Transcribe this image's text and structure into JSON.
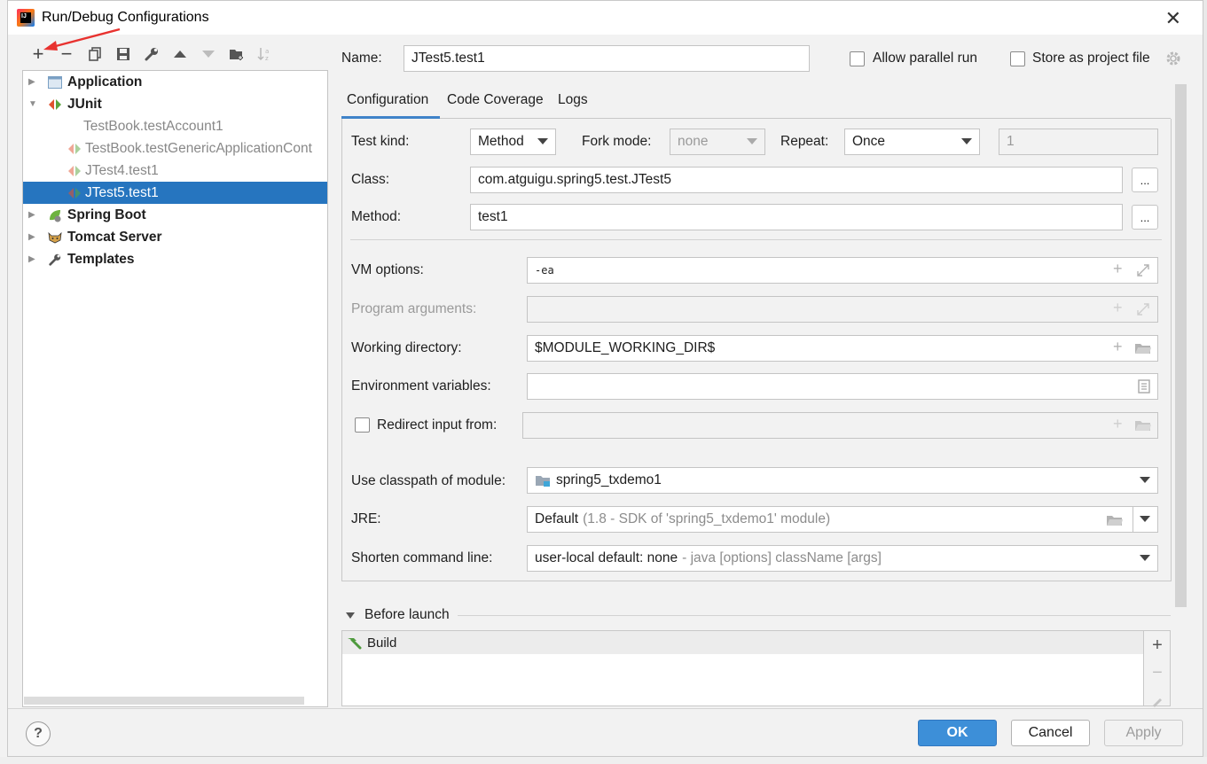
{
  "window": {
    "title": "Run/Debug Configurations",
    "app_icon": "intellij-icon",
    "close": "✕"
  },
  "toolbar": {
    "items": [
      {
        "name": "add-icon",
        "glyph": "+"
      },
      {
        "name": "remove-icon",
        "glyph": "−"
      },
      {
        "name": "copy-icon",
        "glyph": "⧉"
      },
      {
        "name": "save-icon",
        "glyph": "▣"
      },
      {
        "name": "wrench-icon",
        "glyph": "🔧"
      },
      {
        "name": "move-up-icon",
        "glyph": "▲"
      },
      {
        "name": "move-down-icon",
        "glyph": "▼"
      },
      {
        "name": "new-folder-icon",
        "glyph": "▰"
      },
      {
        "name": "sort-icon",
        "glyph": "↓ᵃᶻ"
      }
    ]
  },
  "tree": {
    "application": "Application",
    "junit": "JUnit",
    "junit_children": [
      "TestBook.testAccount1",
      "TestBook.testGenericApplicationCont",
      "JTest4.test1",
      "JTest5.test1"
    ],
    "spring_boot": "Spring Boot",
    "tomcat": "Tomcat Server",
    "templates": "Templates"
  },
  "header": {
    "name_label": "Name:",
    "name_value": "JTest5.test1",
    "allow_parallel": "Allow parallel run",
    "store_project": "Store as project file"
  },
  "tabs": [
    "Configuration",
    "Code Coverage",
    "Logs"
  ],
  "config": {
    "test_kind_label": "Test kind:",
    "test_kind_value": "Method",
    "fork_mode_label": "Fork mode:",
    "fork_mode_value": "none",
    "repeat_label": "Repeat:",
    "repeat_value": "Once",
    "repeat_count": "1",
    "class_label": "Class:",
    "class_value": "com.atguigu.spring5.test.JTest5",
    "method_label": "Method:",
    "method_value": "test1",
    "dots": "...",
    "vm_label": "VM options:",
    "vm_value": "-ea",
    "program_args_label": "Program arguments:",
    "workdir_label": "Working directory:",
    "workdir_value": "$MODULE_WORKING_DIR$",
    "env_label": "Environment variables:",
    "redirect_label": "Redirect input from:",
    "classpath_label": "Use classpath of module:",
    "classpath_value": "spring5_txdemo1",
    "jre_label": "JRE:",
    "jre_value_main": "Default",
    "jre_value_dim": "(1.8 - SDK of 'spring5_txdemo1' module)",
    "shorten_label": "Shorten command line:",
    "shorten_value_main": "user-local default: none",
    "shorten_value_dim": "- java [options] className [args]"
  },
  "before_launch": {
    "title": "Before launch",
    "items": [
      "Build"
    ]
  },
  "footer": {
    "help": "?",
    "ok": "OK",
    "cancel": "Cancel",
    "apply": "Apply"
  },
  "colors": {
    "selection": "#2675bf",
    "ok_button": "#3d8fd8",
    "annotation_arrow": "#e8322f"
  }
}
